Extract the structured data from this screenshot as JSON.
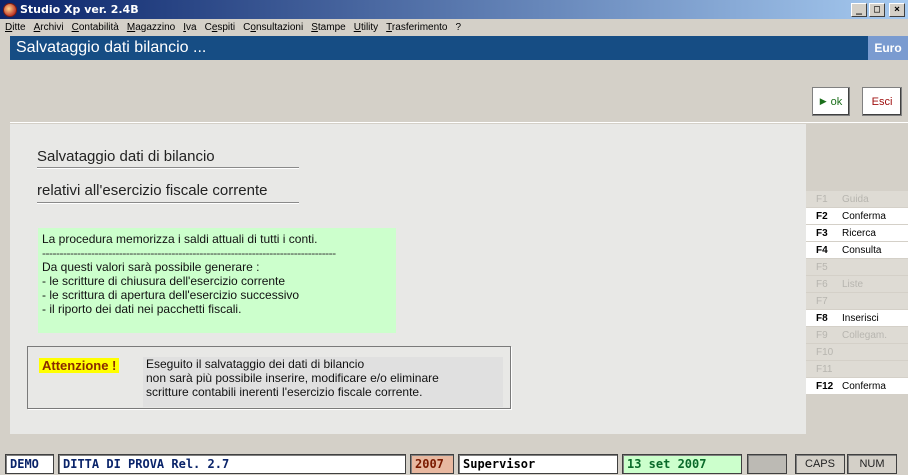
{
  "window": {
    "title": "Studio Xp ver. 2.4B",
    "min": "_",
    "max": "□",
    "close": "×"
  },
  "menu": [
    {
      "pre": "",
      "u": "D",
      "post": "itte"
    },
    {
      "pre": "",
      "u": "A",
      "post": "rchivi"
    },
    {
      "pre": "",
      "u": "C",
      "post": "ontabilità"
    },
    {
      "pre": "",
      "u": "M",
      "post": "agazzino"
    },
    {
      "pre": "",
      "u": "I",
      "post": "va"
    },
    {
      "pre": "C",
      "u": "e",
      "post": "spiti"
    },
    {
      "pre": "C",
      "u": "o",
      "post": "nsultazioni"
    },
    {
      "pre": "",
      "u": "S",
      "post": "tampe"
    },
    {
      "pre": "",
      "u": "U",
      "post": "tility"
    },
    {
      "pre": "",
      "u": "T",
      "post": "rasferimento"
    },
    {
      "pre": "",
      "u": "",
      "post": "?"
    }
  ],
  "header": {
    "title": "Salvataggio dati bilancio ...",
    "currency": "Euro"
  },
  "toolbar": {
    "ok_label": "ok",
    "esci_label": "Esci"
  },
  "main": {
    "heading1": "Salvataggio dati di bilancio",
    "heading2": "relativi all'esercizio fiscale corrente",
    "info": {
      "line1": "La procedura memorizza i saldi attuali di tutti i conti.",
      "separator": "------------------------------------------------------------------------------------",
      "line2": "Da questi valori sarà possibile generare :",
      "line3": "- le scritture di chiusura dell'esercizio corrente",
      "line4": "- le scrittura di apertura dell'esercizio successivo",
      "line5": "- il riporto dei dati nei pacchetti fiscali."
    },
    "warning": {
      "label": "Attenzione !",
      "line1": "Eseguito il salvataggio dei dati di bilancio",
      "line2": "non sarà più possibile inserire, modificare e/o eliminare",
      "line3": "scritture contabili inerenti l'esercizio fiscale corrente."
    }
  },
  "fkeys": [
    {
      "key": "F1",
      "label": "Guida",
      "active": false
    },
    {
      "key": "F2",
      "label": "Conferma",
      "active": true
    },
    {
      "key": "F3",
      "label": "Ricerca",
      "active": true
    },
    {
      "key": "F4",
      "label": "Consulta",
      "active": true
    },
    {
      "key": "F5",
      "label": "",
      "active": false
    },
    {
      "key": "F6",
      "label": "Liste",
      "active": false
    },
    {
      "key": "F7",
      "label": "",
      "active": false
    },
    {
      "key": "F8",
      "label": "Inserisci",
      "active": true
    },
    {
      "key": "F9",
      "label": "Collegam.",
      "active": false
    },
    {
      "key": "F10",
      "label": "",
      "active": false
    },
    {
      "key": "F11",
      "label": "",
      "active": false
    },
    {
      "key": "F12",
      "label": "Conferma",
      "active": true
    }
  ],
  "status": {
    "demo": "DEMO",
    "ditta": "DITTA DI PROVA Rel. 2.7",
    "year": "2007",
    "user": "Supervisor",
    "date": "13 set 2007",
    "caps": "CAPS",
    "num": "NUM"
  }
}
